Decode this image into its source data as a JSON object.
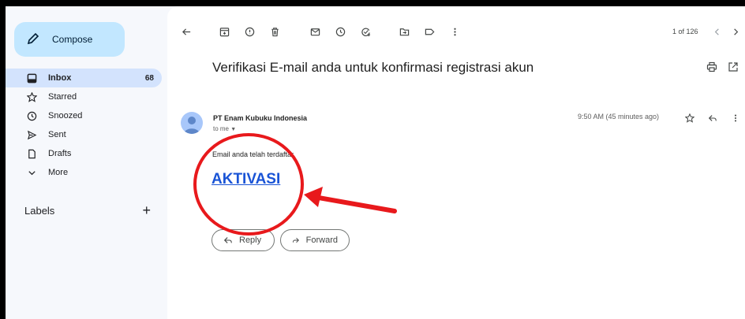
{
  "sidebar": {
    "compose_label": "Compose",
    "items": [
      {
        "label": "Inbox",
        "count": "68"
      },
      {
        "label": "Starred"
      },
      {
        "label": "Snoozed"
      },
      {
        "label": "Sent"
      },
      {
        "label": "Drafts"
      },
      {
        "label": "More"
      }
    ],
    "labels_heading": "Labels",
    "labels_add": "+"
  },
  "toolbar": {
    "pager": "1 of 126"
  },
  "email": {
    "subject": "Verifikasi E-mail anda untuk konfirmasi registrasi akun",
    "sender": "PT Enam Kubuku Indonesia",
    "recipient": "to me",
    "timestamp": "9:50 AM (45 minutes ago)",
    "body": "Email anda telah terdaftar",
    "activation_link": "AKTIVASI",
    "reply_label": "Reply",
    "forward_label": "Forward"
  },
  "colors": {
    "compose_bg": "#c2e7ff",
    "inbox_active_bg": "#d3e3fd",
    "link": "#1a54d6",
    "annotation": "#e8191c"
  }
}
